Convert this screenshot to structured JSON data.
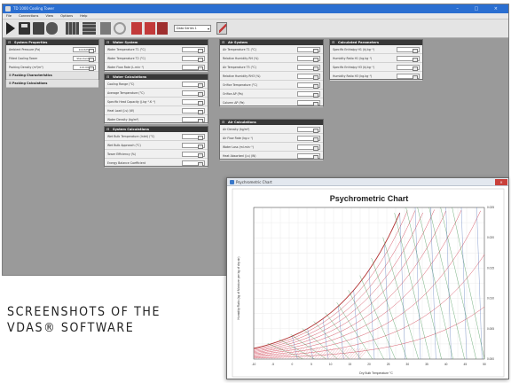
{
  "window": {
    "title": "TD 1000 Cooling Tower",
    "controls": "–  □  ×",
    "menu": [
      "File",
      "Connections",
      "View",
      "Options",
      "Help"
    ],
    "toolbar": {
      "icons": [
        "play-icon",
        "save-icon",
        "open-icon",
        "camera-icon",
        "grid-icon",
        "table-icon",
        "chart-icon",
        "circle-icon",
        "red-chart-icon",
        "red-chart-icon",
        "red-chart-icon",
        "pen-icon"
      ],
      "series_select": "Data Series 1"
    }
  },
  "panels": {
    "system_properties": {
      "title": "System Properties",
      "rows": [
        {
          "label": "Ambient Pressure (Pa)",
          "value": "101325"
        },
        {
          "label": "Fitted Cooling Tower",
          "value": "Standard"
        },
        {
          "label": "Packing Density (m²/m³)",
          "value": "110.00"
        }
      ],
      "sections": [
        "Packing Characteristics",
        "Packing Calculations"
      ]
    },
    "water_system": {
      "title": "Water System",
      "rows": [
        {
          "label": "Water Temperature T1 (°C)",
          "value": ""
        },
        {
          "label": "Water Temperature T2 (°C)",
          "value": ""
        },
        {
          "label": "Water Flow Rate (L.min⁻¹)",
          "value": ""
        }
      ]
    },
    "water_calculations": {
      "title": "Water Calculations",
      "rows": [
        {
          "label": "Cooling Range (°C)",
          "value": ""
        },
        {
          "label": "Average Temperature (°C)",
          "value": ""
        },
        {
          "label": "Specific Heat Capacity (J.kg⁻¹.K⁻¹)",
          "value": ""
        },
        {
          "label": "Heat Load (J.s) (W)",
          "value": ""
        },
        {
          "label": "Water Density (kg/m³)",
          "value": ""
        }
      ]
    },
    "system_calculations": {
      "title": "System Calculations",
      "rows": [
        {
          "label": "Wet Bulb Temperature (Inlet) (°C)",
          "value": ""
        },
        {
          "label": "Wet Bulb Approach (°C)",
          "value": ""
        },
        {
          "label": "Tower Efficiency (%)",
          "value": ""
        },
        {
          "label": "Energy Balance Coefficient",
          "value": ""
        }
      ]
    },
    "air_system": {
      "title": "Air System",
      "rows": [
        {
          "label": "Air Temperature T1 (°C)",
          "value": ""
        },
        {
          "label": "Relative Humidity RH (%)",
          "value": ""
        },
        {
          "label": "Air Temperature T3 (°C)",
          "value": ""
        },
        {
          "label": "Relative Humidity RH3 (%)",
          "value": ""
        },
        {
          "label": "Orifice Temperature (°C)",
          "value": ""
        },
        {
          "label": "Orifice ΔP (Pa)",
          "value": ""
        },
        {
          "label": "Column ΔP (Pa)",
          "value": ""
        }
      ]
    },
    "air_calculations": {
      "title": "Air Calculations",
      "rows": [
        {
          "label": "Air Density (kg/m³)",
          "value": ""
        },
        {
          "label": "Air Flow Rate (kg.s⁻¹)",
          "value": ""
        },
        {
          "label": "Water Loss (ml.min⁻¹)",
          "value": ""
        },
        {
          "label": "Heat Absorbed (J.s) (W)",
          "value": ""
        }
      ]
    },
    "calculated_parameters": {
      "title": "Calculated Parameters",
      "rows": [
        {
          "label": "Specific Enthalpy H1 (kJ.kg⁻¹)",
          "value": ""
        },
        {
          "label": "Humidity Ratio H1 (kg.kg⁻¹)",
          "value": ""
        },
        {
          "label": "Specific Enthalpy H3 (kJ.kg⁻¹)",
          "value": ""
        },
        {
          "label": "Humidity Ratio H3 (kg.kg⁻¹)",
          "value": ""
        }
      ]
    }
  },
  "psychrometric_window": {
    "title": "Psychrometric Chart",
    "close_label": "×",
    "chart_title": "Psychrometric Chart",
    "x_label": "Dry Bulb Temperature °C",
    "y_label": "Humidity Ratio (kg of Moisture per kg of dry air)",
    "x_ticks": [
      "-10",
      "-5",
      "0",
      "5",
      "10",
      "15",
      "20",
      "25",
      "30",
      "35",
      "40",
      "45",
      "50"
    ],
    "y_ticks": [
      "0.000",
      "0.005",
      "0.010",
      "0.015",
      "0.020",
      "0.025"
    ]
  },
  "caption": {
    "line1": "SCREENSHOTS OF THE",
    "line2": "VDAS® SOFTWARE"
  }
}
